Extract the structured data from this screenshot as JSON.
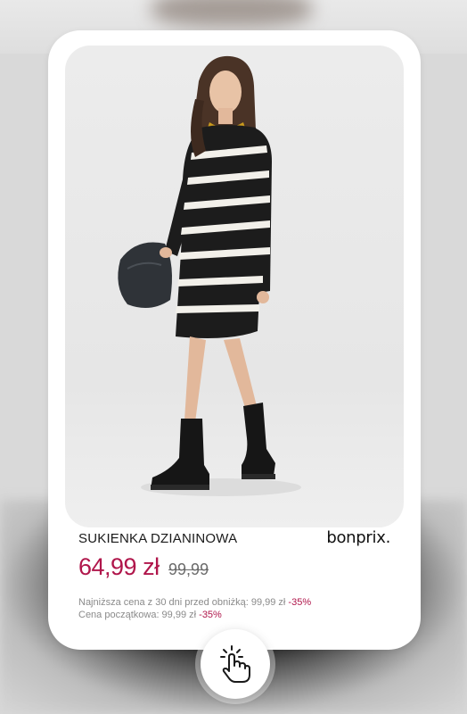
{
  "product": {
    "title": "SUKIENKA DZIANINOWA",
    "brand": "bonprix.",
    "price": "64,99 zł",
    "old_price": "99,99",
    "lowest_price_label": "Najniższa cena z 30 dni  przed obniżką: 99,99 zł",
    "lowest_price_discount": "-35%",
    "initial_price_label": "Cena początkowa: 99,99 zł",
    "initial_price_discount": "-35%"
  },
  "colors": {
    "price": "#b0164b",
    "card_background": "#ffffff",
    "dress_dark": "#1c1c1c",
    "dress_stripe": "#f2f0ea"
  },
  "icons": {
    "tap": "hand-tap-icon"
  }
}
